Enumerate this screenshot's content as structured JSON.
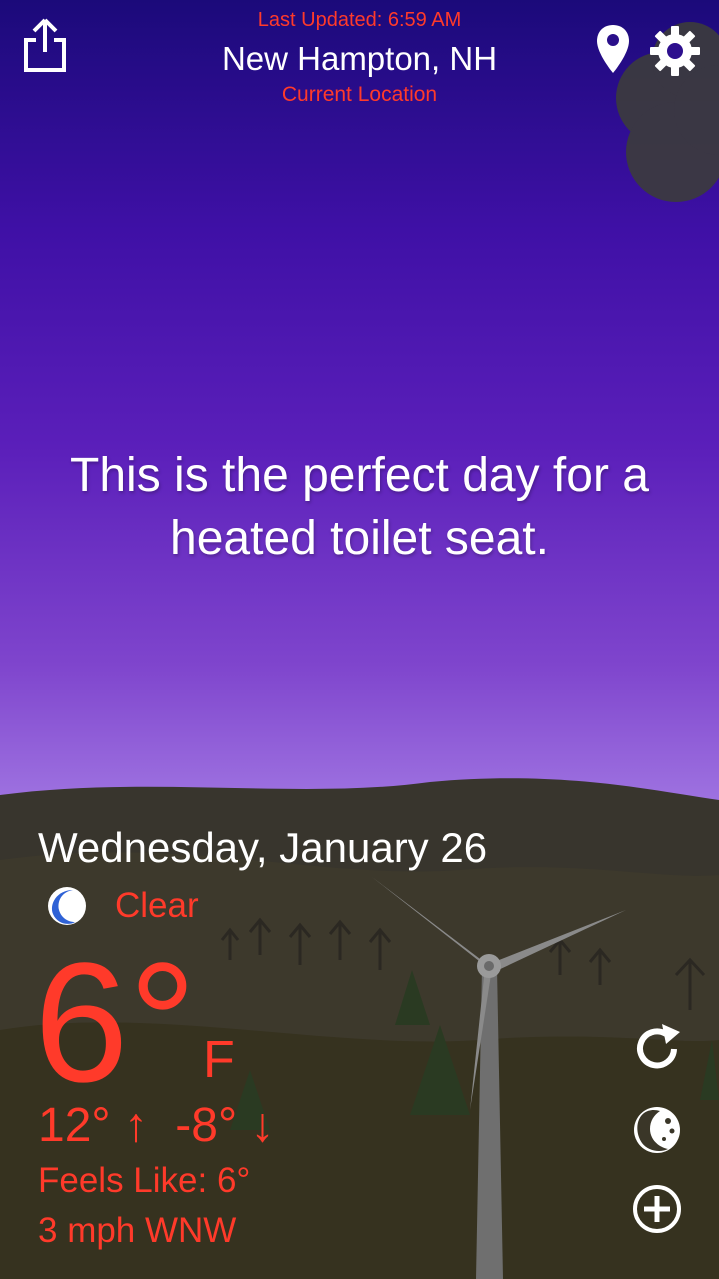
{
  "header": {
    "last_updated": "Last Updated: 6:59 AM",
    "city": "New Hampton, NH",
    "location_label": "Current Location"
  },
  "message": {
    "line1": "This is the perfect day for a",
    "line2": "heated toilet seat."
  },
  "weather": {
    "date": "Wednesday, January 26",
    "condition": "Clear",
    "condition_icon": "moon-icon",
    "temperature": "6°",
    "unit": "F",
    "high": "12°",
    "low": "-8°",
    "feels_like": "Feels Like: 6°",
    "wind": "3 mph WNW"
  },
  "icons": {
    "share": "share-icon",
    "location": "map-pin-icon",
    "settings": "gear-icon",
    "refresh": "refresh-icon",
    "theme": "theme-icon",
    "add": "add-icon"
  },
  "colors": {
    "accent": "#ff3a2a",
    "sky_top": "#1b0a7a",
    "sky_bottom": "#b9a2f2",
    "ground": "#3a3628"
  }
}
